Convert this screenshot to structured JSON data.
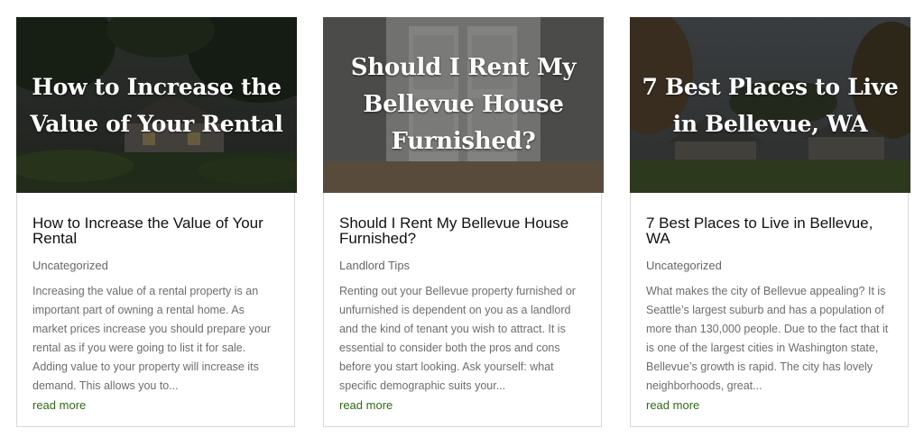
{
  "posts": [
    {
      "image_title": "How to Increase the Value of Your Rental",
      "title": "How to Increase the Value of Your Rental",
      "category": "Uncategorized",
      "excerpt": "Increasing the value of a rental property is an important part of owning a rental home. As market prices increase you should prepare your rental as if you were going to list it for sale. Adding value to your property will increase its demand. This allows you to...",
      "read_more": "read more"
    },
    {
      "image_title": "Should I Rent My Bellevue House Furnished?",
      "title": "Should I Rent My Bellevue House Furnished?",
      "category": "Landlord Tips",
      "excerpt": "Renting out your Bellevue property furnished or unfurnished is dependent on you as a landlord and the kind of tenant you wish to attract. It is essential to consider both the pros and cons before you start looking. Ask yourself: what specific demographic suits your...",
      "read_more": "read more"
    },
    {
      "image_title": "7 Best Places to Live in Bellevue, WA",
      "title": "7 Best Places to Live in Bellevue, WA",
      "category": "Uncategorized",
      "excerpt": "What makes the city of Bellevue appealing? It is Seattle’s largest suburb and has a population of more than 130,000 people. Due to the fact that it is one of the largest cities in Washington state, Bellevue’s growth is rapid. The city has lovely neighborhoods, great...",
      "read_more": "read more"
    }
  ],
  "colors": {
    "link": "#2f6b14",
    "title": "#111111",
    "meta": "#666666",
    "excerpt": "#6d6d6d",
    "border": "#d9d9d9"
  }
}
